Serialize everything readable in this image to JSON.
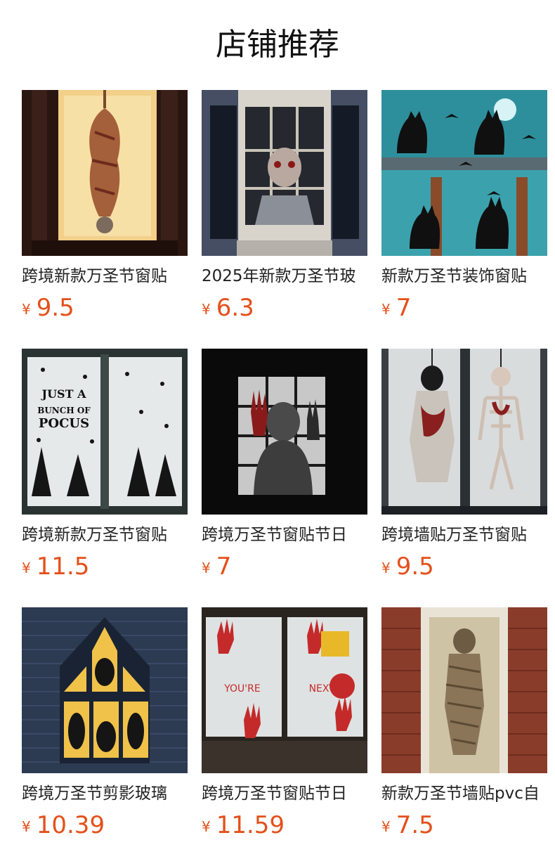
{
  "header": {
    "title": "店铺推荐"
  },
  "products": [
    {
      "name": "跨境新款万圣节窗贴",
      "currency": "¥",
      "price": "9.5",
      "image_icon": "hanging-body-bag-image"
    },
    {
      "name": "2025年新款万圣节玻",
      "currency": "¥",
      "price": "6.3",
      "image_icon": "zombie-window-image"
    },
    {
      "name": "新款万圣节装饰窗贴",
      "currency": "¥",
      "price": "7",
      "image_icon": "black-cat-window-image"
    },
    {
      "name": "跨境新款万圣节窗贴",
      "currency": "¥",
      "price": "11.5",
      "image_icon": "hocus-pocus-window-image"
    },
    {
      "name": "跨境万圣节窗贴节日",
      "currency": "¥",
      "price": "7",
      "image_icon": "shadow-hands-window-image"
    },
    {
      "name": "跨境墙贴万圣节窗贴",
      "currency": "¥",
      "price": "9.5",
      "image_icon": "ghost-skeleton-window-image"
    },
    {
      "name": "跨境万圣节剪影玻璃",
      "currency": "¥",
      "price": "10.39",
      "image_icon": "monster-silhouette-house-image"
    },
    {
      "name": "跨境万圣节窗贴节日",
      "currency": "¥",
      "price": "11.59",
      "image_icon": "bloody-handprint-window-image"
    },
    {
      "name": "新款万圣节墙贴pvc自",
      "currency": "¥",
      "price": "7.5",
      "image_icon": "mummy-door-image"
    }
  ],
  "colors": {
    "accent_price": "#e4501a",
    "text": "#222222"
  }
}
